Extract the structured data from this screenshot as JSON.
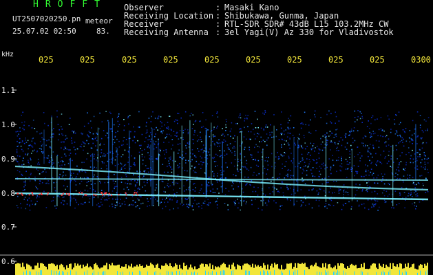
{
  "header": {
    "title": "HROFFT",
    "file_name": "UT2507020250.pn",
    "meteor_label": "meteor",
    "date_time": "25.07.02 02:50",
    "meteor_count": "83."
  },
  "info": [
    {
      "label": "Observer",
      "value": "Masaki Kano"
    },
    {
      "label": "Receiving Location",
      "value": "Shibukawa, Gunma, Japan"
    },
    {
      "label": "Receiver",
      "value": "RTL-SDR SDR# 43dB L15 103.2MHz CW"
    },
    {
      "label": "Receiving Antenna",
      "value": "3el Yagi(V) Az 330 for Vladivostok"
    }
  ],
  "axes": {
    "y_unit": "kHz",
    "y_ticks": [
      "1.1",
      "1.0",
      "0.9",
      "0.8",
      "0.7",
      "0.6"
    ],
    "x_ticks": [
      "025",
      "025",
      "025",
      "025",
      "025",
      "025",
      "025",
      "025",
      "025",
      "0300"
    ]
  },
  "colors": {
    "background": "#000000",
    "header_text": "#32ff32",
    "label_text": "#e8e8e8",
    "tick_text": "#f2e63a",
    "noise_low": "#0b2fd0",
    "noise_mid": "#1f7dff",
    "signal": "#7cf2ff",
    "hot": "#ff3b3b",
    "power_bar": "#f2e63a",
    "power_bar_low": "#25d4ff"
  }
}
